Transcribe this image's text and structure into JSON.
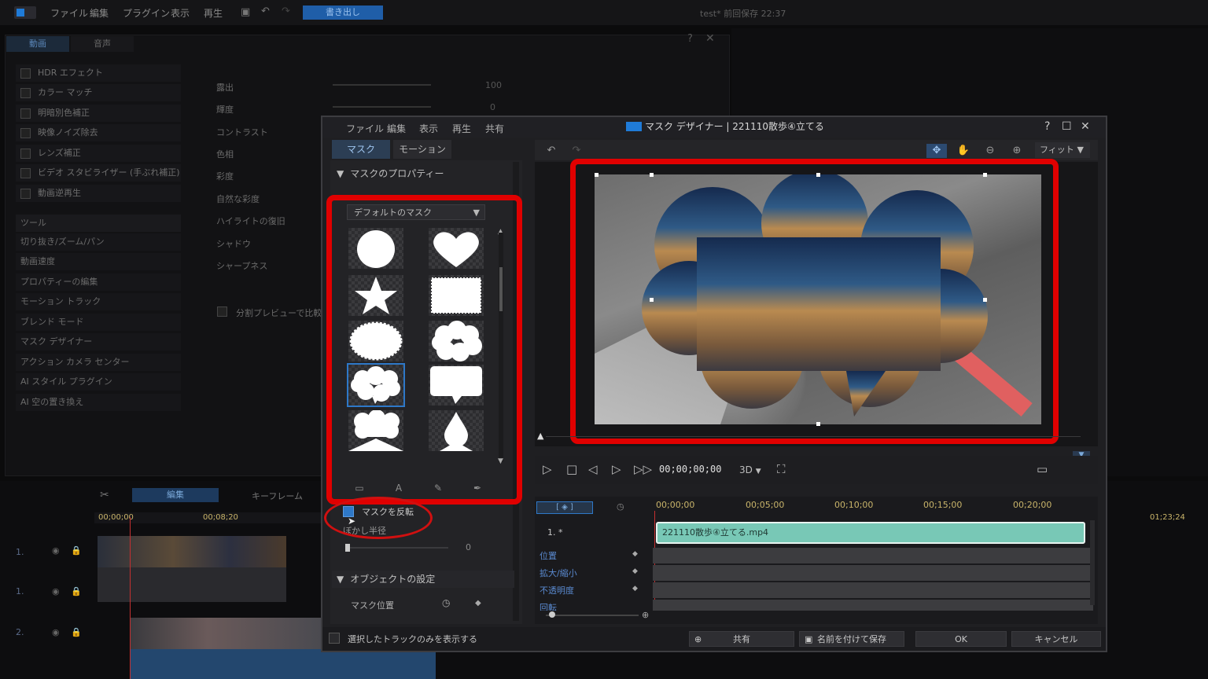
{
  "app": {
    "menu": [
      "ファイル",
      "編集",
      "プラグイン",
      "表示",
      "再生"
    ],
    "export_label": "書き出し",
    "doc_title": "test* 前回保存 22:37"
  },
  "left_panel": {
    "tabs": [
      "動画",
      "音声"
    ],
    "effects": [
      "HDR エフェクト",
      "カラー マッチ",
      "明暗別色補正",
      "映像ノイズ除去",
      "レンズ補正",
      "ビデオ スタビライザー (手ぶれ補正)",
      "動画逆再生"
    ],
    "tools_header": "ツール",
    "tools": [
      "切り抜き/ズーム/パン",
      "動画速度",
      "プロパティーの編集",
      "モーション トラック",
      "ブレンド モード",
      "マスク デザイナー",
      "アクション カメラ センター",
      "AI スタイル プラグイン",
      "AI 空の置き換え"
    ],
    "sliders": [
      {
        "label": "露出",
        "value": "100"
      },
      {
        "label": "輝度",
        "value": "0"
      },
      {
        "label": "コントラスト",
        "value": ""
      },
      {
        "label": "色相",
        "value": ""
      },
      {
        "label": "彩度",
        "value": ""
      },
      {
        "label": "自然な彩度",
        "value": ""
      },
      {
        "label": "ハイライトの復旧",
        "value": ""
      },
      {
        "label": "シャドウ",
        "value": ""
      },
      {
        "label": "シャープネス",
        "value": ""
      }
    ],
    "split_preview": "分割プレビューで比較"
  },
  "timeline": {
    "edit_tab": "編集",
    "keyframe_tab": "キーフレーム",
    "ruler": [
      "00;00;00",
      "00;08;20"
    ],
    "right_ruler": "01;23;24",
    "tracks": [
      "1.",
      "1.",
      "2."
    ]
  },
  "dialog": {
    "menu": [
      "ファイル",
      "編集",
      "表示",
      "再生",
      "共有"
    ],
    "title": "マスク デザイナー | 221110散歩④立てる",
    "tabs": [
      "マスク",
      "モーション"
    ],
    "properties_header": "マスクのプロパティー",
    "mask_dropdown": "デフォルトのマスク",
    "invert_label": "マスクを反転",
    "feather_label": "ぼかし半径",
    "feather_value": "0",
    "object_header": "オブジェクトの設定",
    "mask_position": "マスク位置",
    "show_selected": "選択したトラックのみを表示する",
    "fit_label": "フィット",
    "timecode": "00;00;00;00",
    "mode_3d": "3D",
    "kf_ticks": [
      "00;00;00",
      "00;05;00",
      "00;10;00",
      "00;15;00",
      "00;20;00"
    ],
    "kf_track_name": "1. *",
    "clip_name": "221110散歩④立てる.mp4",
    "kf_labels": [
      "位置",
      "拡大/縮小",
      "不透明度",
      "回転"
    ],
    "buttons": {
      "share": "共有",
      "save_as": "名前を付けて保存",
      "ok": "OK",
      "cancel": "キャンセル"
    }
  },
  "colors": {
    "accent": "#1f7bd8",
    "annotation_red": "#e00000",
    "clip": "#78c8b6"
  }
}
